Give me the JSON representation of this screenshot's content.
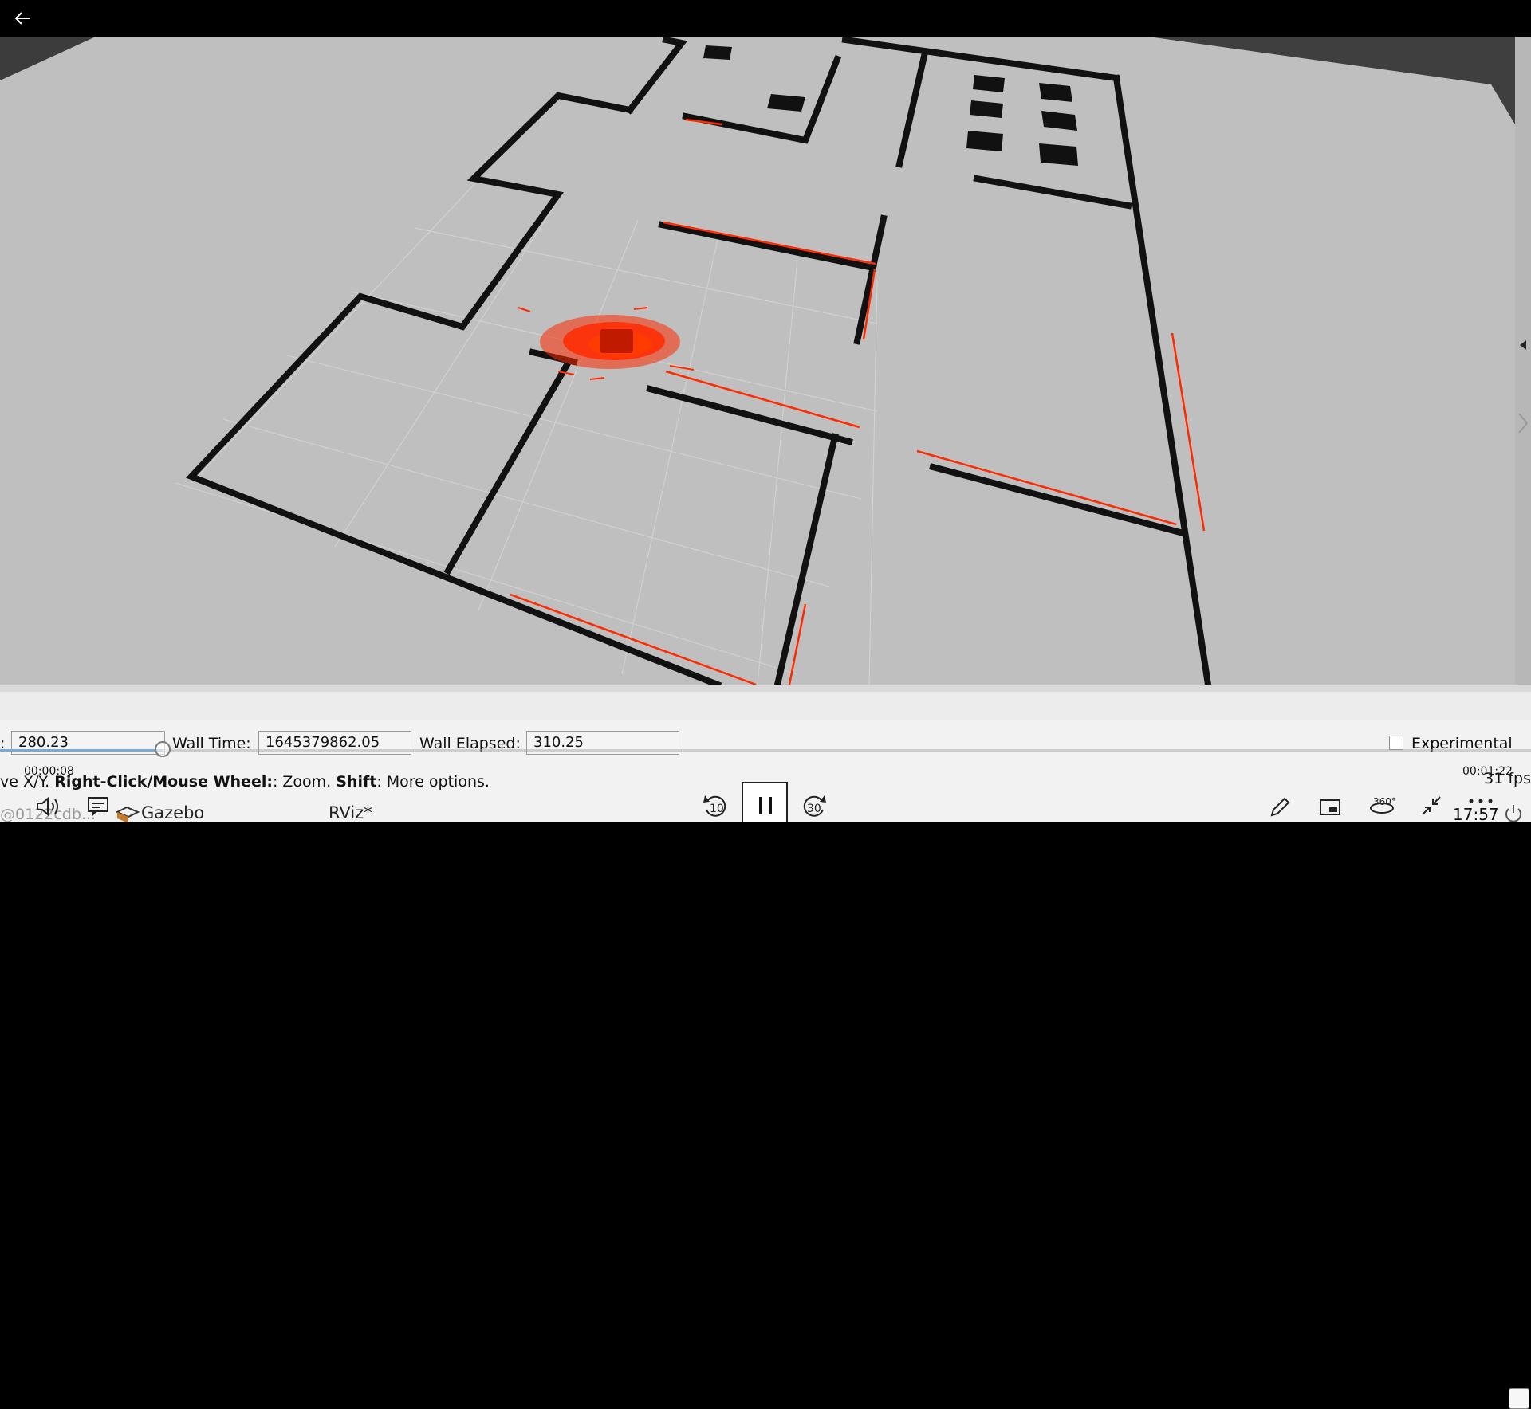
{
  "topbar": {
    "back_icon": "back-arrow-icon"
  },
  "statusbar": {
    "sim_time_label": ":",
    "sim_time_value": "280.23",
    "wall_time_label": "Wall Time:",
    "wall_time_value": "1645379862.05",
    "wall_elapsed_label": "Wall Elapsed:",
    "wall_elapsed_value": "310.25",
    "experimental_label": "Experimental"
  },
  "help": {
    "prefix": "ve X/Y. ",
    "right_click": "Right-Click/Mouse Wheel:",
    "zoom_text": ": Zoom. ",
    "shift": "Shift",
    "more_text": ": More options.",
    "fps": "31 fps"
  },
  "player": {
    "elapsed": "00:00:08",
    "total": "00:01:22",
    "progress_percent": 10,
    "rewind_label": "10",
    "forward_label": "30",
    "immersive_label": "360°"
  },
  "taskbar": {
    "user_text": "@0122cdb...",
    "gazebo_label": "Gazebo",
    "rviz_label": "RViz*",
    "clock": "17:57"
  },
  "colors": {
    "laser": "#ff2a00",
    "walls": "#111111",
    "floor": "#bfbfbf"
  }
}
